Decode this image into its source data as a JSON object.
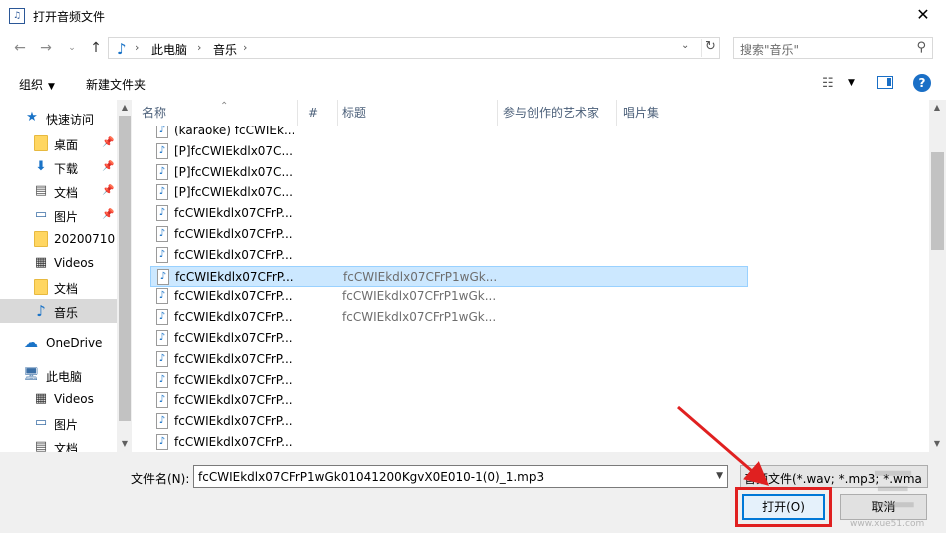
{
  "window": {
    "title": "打开音频文件",
    "close_glyph": "✕"
  },
  "address": {
    "crumbs": [
      "此电脑",
      "音乐"
    ],
    "search_placeholder": "搜索\"音乐\""
  },
  "toolbar": {
    "organize": "组织",
    "new_folder": "新建文件夹"
  },
  "nav": {
    "items": [
      {
        "label": "快速访问",
        "icon": "star-icon",
        "pinned": false
      },
      {
        "label": "桌面",
        "icon": "folder-icon",
        "pinned": true
      },
      {
        "label": "下载",
        "icon": "download-icon",
        "pinned": true
      },
      {
        "label": "文档",
        "icon": "document-icon",
        "pinned": true
      },
      {
        "label": "图片",
        "icon": "picture-icon",
        "pinned": true
      },
      {
        "label": "20200710",
        "icon": "folder-icon",
        "pinned": false
      },
      {
        "label": "Videos",
        "icon": "video-icon",
        "pinned": false
      },
      {
        "label": "文档",
        "icon": "folder-icon",
        "pinned": false
      },
      {
        "label": "音乐",
        "icon": "music-icon",
        "pinned": false,
        "selected": true
      },
      {
        "label": "OneDrive",
        "icon": "cloud-icon",
        "pinned": false
      },
      {
        "label": "此电脑",
        "icon": "computer-icon",
        "pinned": false
      },
      {
        "label": "Videos",
        "icon": "video-icon",
        "pinned": false
      },
      {
        "label": "图片",
        "icon": "picture-icon",
        "pinned": false
      },
      {
        "label": "文档",
        "icon": "document-icon",
        "pinned": false
      }
    ]
  },
  "columns": [
    "名称",
    "#",
    "标题",
    "参与创作的艺术家",
    "唱片集"
  ],
  "files": [
    {
      "name": "(karaoke) fcCWIEk...",
      "title": ""
    },
    {
      "name": "[P]fcCWIEkdlx07C...",
      "title": ""
    },
    {
      "name": "[P]fcCWIEkdlx07C...",
      "title": ""
    },
    {
      "name": "[P]fcCWIEkdlx07C...",
      "title": ""
    },
    {
      "name": "fcCWIEkdlx07CFrP...",
      "title": ""
    },
    {
      "name": "fcCWIEkdlx07CFrP...",
      "title": ""
    },
    {
      "name": "fcCWIEkdlx07CFrP...",
      "title": ""
    },
    {
      "name": "fcCWIEkdlx07CFrP...",
      "title": "fcCWIEkdlx07CFrP1wGk...",
      "selected": true
    },
    {
      "name": "fcCWIEkdlx07CFrP...",
      "title": "fcCWIEkdlx07CFrP1wGk..."
    },
    {
      "name": "fcCWIEkdlx07CFrP...",
      "title": "fcCWIEkdlx07CFrP1wGk..."
    },
    {
      "name": "fcCWIEkdlx07CFrP...",
      "title": ""
    },
    {
      "name": "fcCWIEkdlx07CFrP...",
      "title": ""
    },
    {
      "name": "fcCWIEkdlx07CFrP...",
      "title": ""
    },
    {
      "name": "fcCWIEkdlx07CFrP...",
      "title": ""
    },
    {
      "name": "fcCWIEkdlx07CFrP...",
      "title": ""
    },
    {
      "name": "fcCWIEkdlx07CFrP...",
      "title": ""
    }
  ],
  "bottom": {
    "filename_label": "文件名(N):",
    "filename_value": "fcCWIEkdlx07CFrP1wGk01041200KgvX0E010-1(0)_1.mp3",
    "filter_value": "音频文件(*.wav; *.mp3; *.wma",
    "open_label": "打开(O)",
    "cancel_label": "取消"
  },
  "watermark": {
    "glyph": "三",
    "sub": "www.xue51.com"
  },
  "colors": {
    "accent": "#0078d7",
    "selection": "#cce8ff",
    "highlight": "#e02020"
  }
}
